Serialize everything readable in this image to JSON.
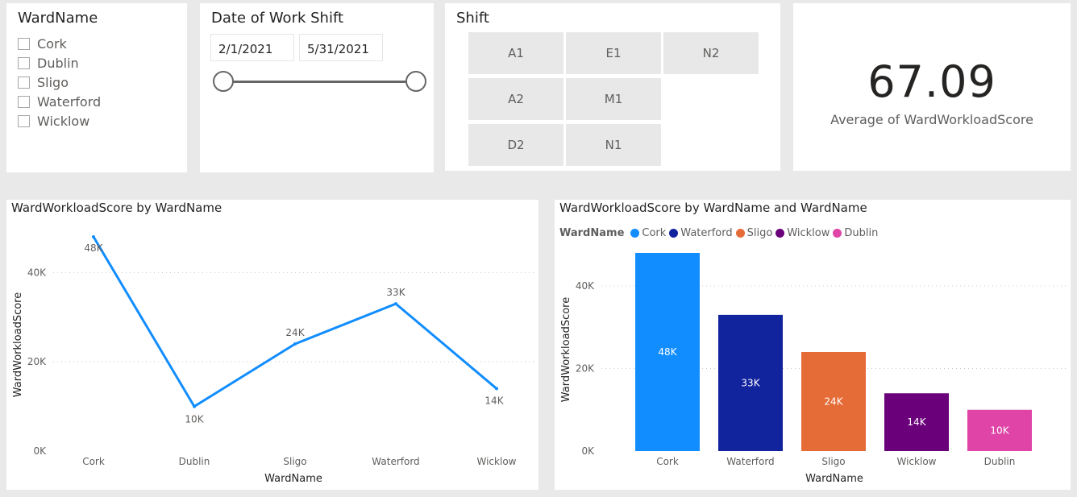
{
  "ward_slicer": {
    "title": "WardName",
    "items": [
      {
        "label": "Cork"
      },
      {
        "label": "Dublin"
      },
      {
        "label": "Sligo"
      },
      {
        "label": "Waterford"
      },
      {
        "label": "Wicklow"
      }
    ]
  },
  "date_slicer": {
    "title": "Date of Work Shift",
    "start": "2/1/2021",
    "end": "5/31/2021"
  },
  "shift_slicer": {
    "title": "Shift",
    "tiles": [
      {
        "label": "A1"
      },
      {
        "label": "E1"
      },
      {
        "label": "N2"
      },
      {
        "label": "A2"
      },
      {
        "label": "M1"
      },
      {
        "label": "D2"
      },
      {
        "label": "N1"
      }
    ]
  },
  "kpi": {
    "value": "67.09",
    "label": "Average of WardWorkloadScore"
  },
  "chart_data": [
    {
      "type": "line",
      "title": "WardWorkloadScore by WardName",
      "xlabel": "WardName",
      "ylabel": "WardWorkloadScore",
      "categories": [
        "Cork",
        "Dublin",
        "Sligo",
        "Waterford",
        "Wicklow"
      ],
      "values": [
        48000,
        10000,
        24000,
        33000,
        14000
      ],
      "data_labels": [
        "48K",
        "10K",
        "24K",
        "33K",
        "14K"
      ],
      "yticks": [
        "0K",
        "20K",
        "40K"
      ],
      "ylim": [
        0,
        48000
      ],
      "grid": true,
      "color": "#118DFF"
    },
    {
      "type": "bar",
      "title": "WardWorkloadScore by WardName and WardName",
      "xlabel": "WardName",
      "ylabel": "WardWorkloadScore",
      "legend_title": "WardName",
      "legend_position": "top-left",
      "legend": [
        {
          "name": "Cork",
          "color": "#118DFF"
        },
        {
          "name": "Waterford",
          "color": "#12239E"
        },
        {
          "name": "Sligo",
          "color": "#E66C37"
        },
        {
          "name": "Wicklow",
          "color": "#6B007B"
        },
        {
          "name": "Dublin",
          "color": "#E044A7"
        }
      ],
      "categories": [
        "Cork",
        "Waterford",
        "Sligo",
        "Wicklow",
        "Dublin"
      ],
      "values": [
        48000,
        33000,
        24000,
        14000,
        10000
      ],
      "data_labels": [
        "48K",
        "33K",
        "24K",
        "14K",
        "10K"
      ],
      "colors": [
        "#118DFF",
        "#12239E",
        "#E66C37",
        "#6B007B",
        "#E044A7"
      ],
      "yticks": [
        "0K",
        "20K",
        "40K"
      ],
      "ylim": [
        0,
        48000
      ],
      "grid": true
    }
  ]
}
